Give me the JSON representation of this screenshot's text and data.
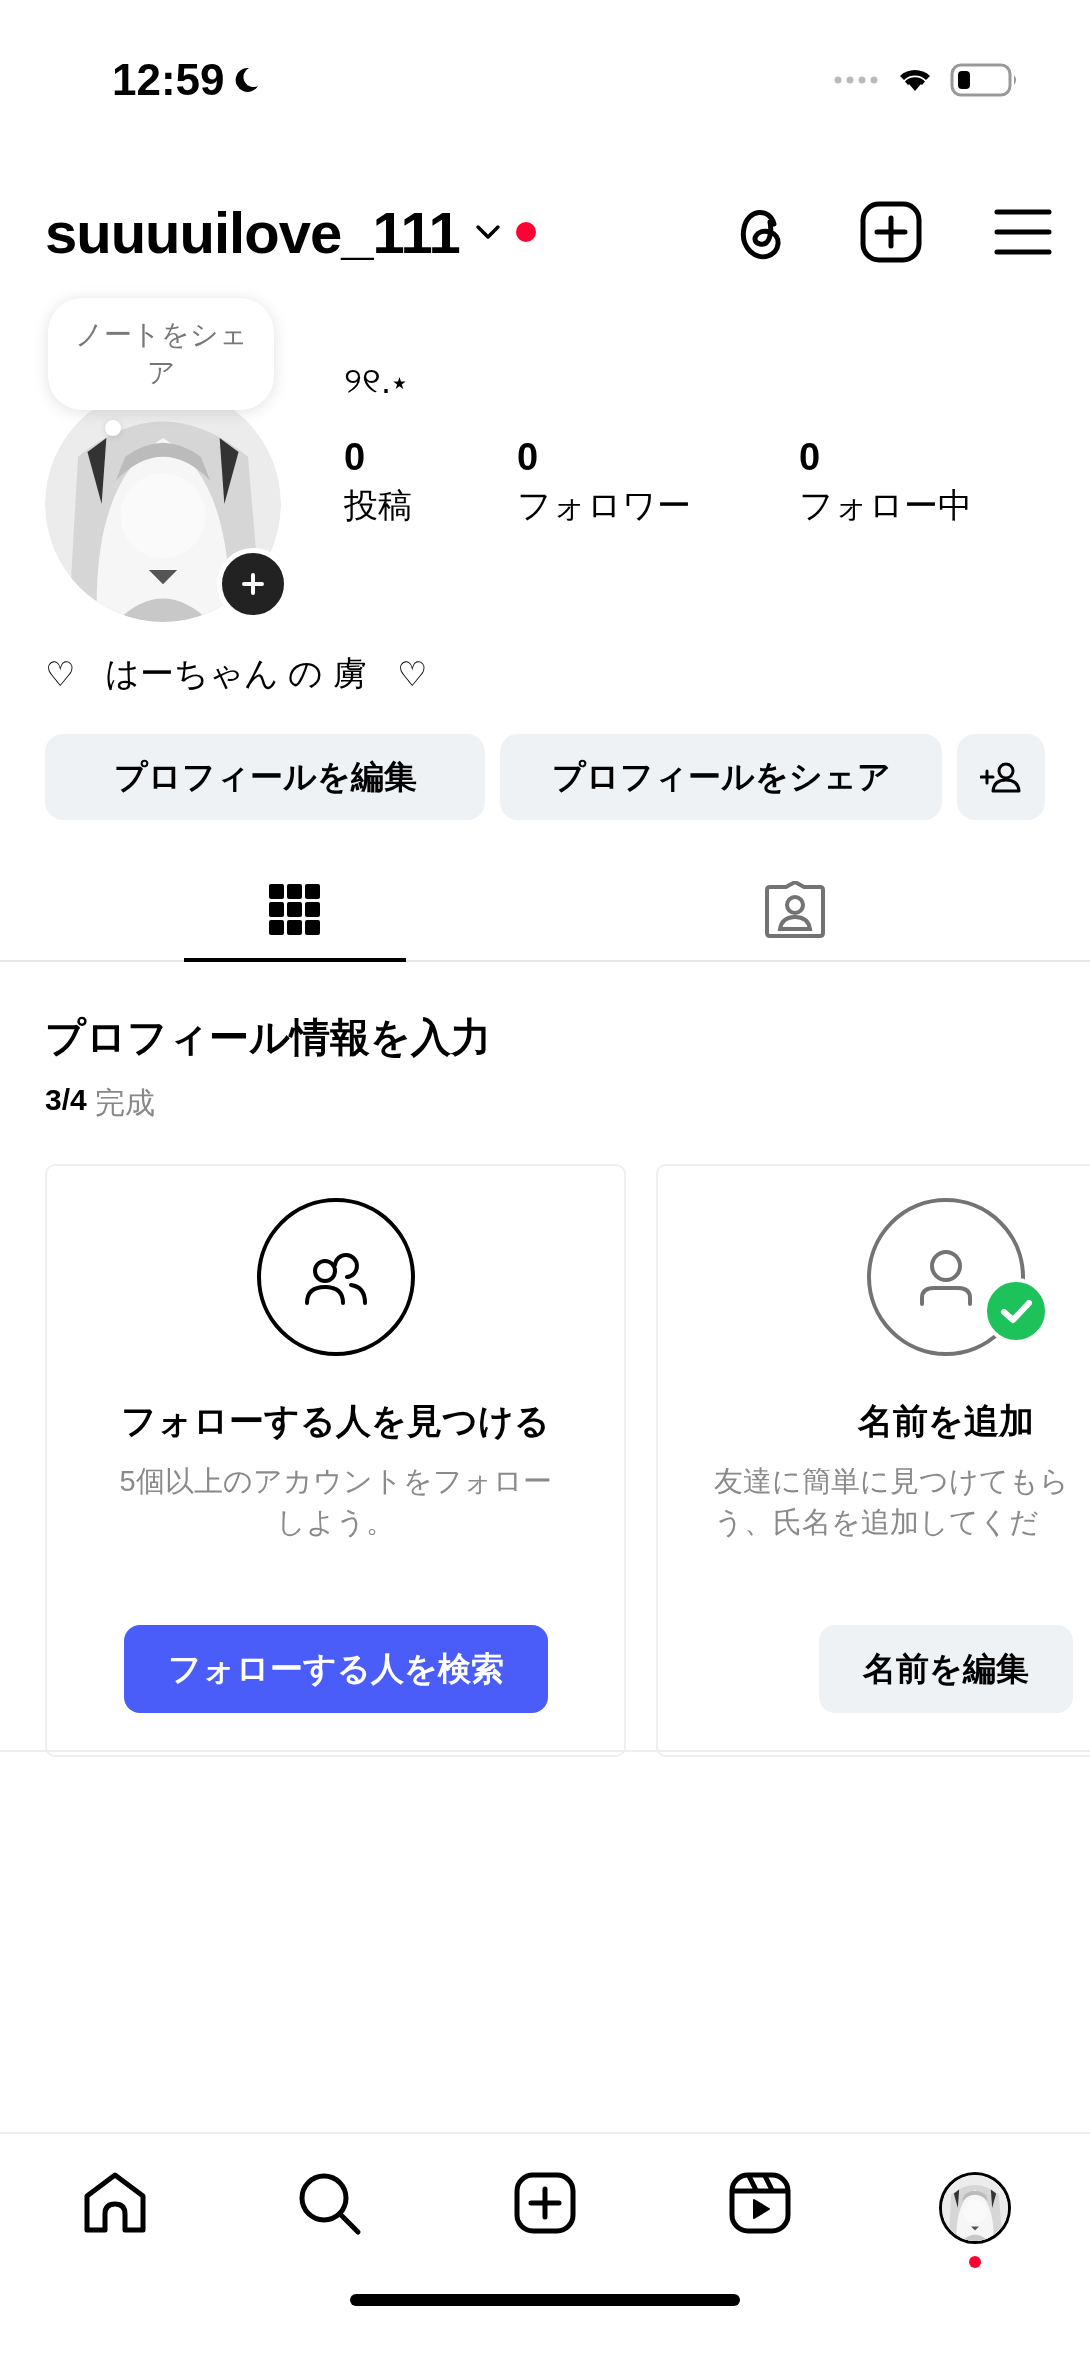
{
  "status_bar": {
    "time": "12:59"
  },
  "header": {
    "username": "suuuuilove_111",
    "notification_dot": true
  },
  "profile": {
    "note_bubble": "ノートをシェア",
    "display_name": "୨୧.⋆",
    "stats": [
      {
        "count": "0",
        "label": "投稿"
      },
      {
        "count": "0",
        "label": "フォロワー"
      },
      {
        "count": "0",
        "label": "フォロー中"
      }
    ],
    "bio": [
      "♡",
      "はーちゃん の 虜",
      "♡"
    ]
  },
  "actions": [
    {
      "kind": "text",
      "label": "プロフィールを編集"
    },
    {
      "kind": "text",
      "label": "プロフィールをシェア"
    },
    {
      "kind": "add_person"
    }
  ],
  "tabs": [
    {
      "kind": "grid",
      "selected": true
    },
    {
      "kind": "tagged",
      "selected": false
    }
  ],
  "setup": {
    "title": "プロフィール情報を入力",
    "progress_count": "3/4",
    "progress_label": "完成",
    "cards": [
      {
        "kind": "people",
        "completed": false,
        "title": "フォローする人を見つける",
        "description_lines": [
          "5個以上のアカウントをフォロー",
          "しよう。"
        ],
        "button": "フォローする人を検索",
        "primary": true
      },
      {
        "kind": "person",
        "completed": true,
        "title": "名前を追加",
        "description_lines": [
          "友達に簡単に見つけてもら",
          "う、氏名を追加してくだ"
        ],
        "button": "名前を編集",
        "primary": false
      }
    ]
  },
  "bottom_nav": [
    {
      "kind": "home",
      "selected": false
    },
    {
      "kind": "search",
      "selected": false
    },
    {
      "kind": "create",
      "selected": false
    },
    {
      "kind": "reels",
      "selected": false
    },
    {
      "kind": "profile",
      "selected": true,
      "badge": true
    }
  ]
}
